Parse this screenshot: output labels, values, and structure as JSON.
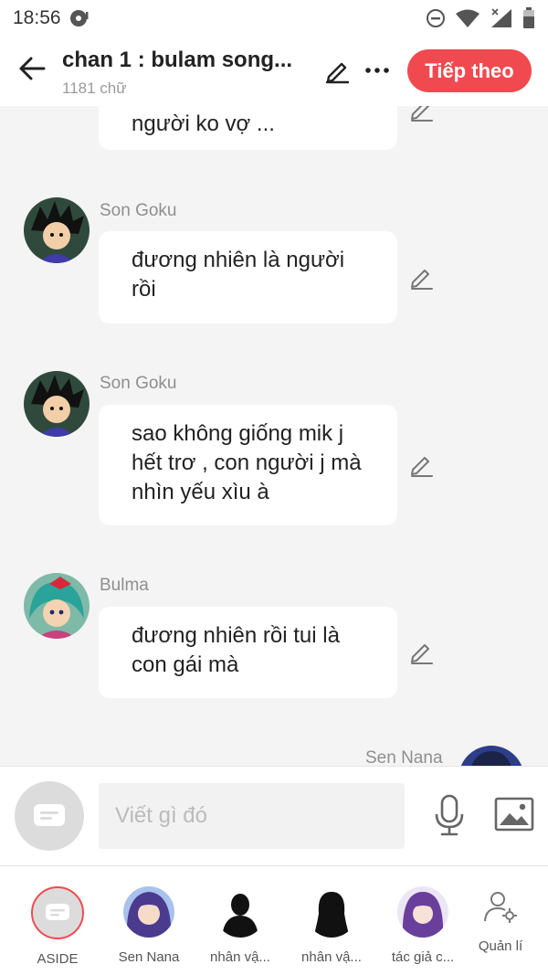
{
  "status_bar": {
    "time": "18:56",
    "icons": [
      "media-icon",
      "do-not-disturb-icon",
      "wifi-icon",
      "signal-icon",
      "battery-icon"
    ]
  },
  "header": {
    "title": "chan 1 : bulam song...",
    "word_count": "1181 chữ",
    "next_label": "Tiếp theo"
  },
  "chat": {
    "messages": [
      {
        "speaker": "",
        "text": "người ko vợ ..."
      },
      {
        "speaker": "Son Goku",
        "text": "đương nhiên là người rồi"
      },
      {
        "speaker": "Son Goku",
        "text": "sao không giống mik j hết trơ , con người j mà nhìn yếu xìu à"
      },
      {
        "speaker": "Bulma",
        "text": "đương nhiên rồi tui là con gái mà"
      },
      {
        "speaker": "Sen Nana",
        "text": ""
      }
    ]
  },
  "composer": {
    "placeholder": "Viết gì đó"
  },
  "characters": [
    {
      "label": "ASIDE"
    },
    {
      "label": "Sen Nana"
    },
    {
      "label": "nhân vậ..."
    },
    {
      "label": "nhân vậ..."
    },
    {
      "label": "tác giả c..."
    },
    {
      "label": "Quản lí"
    }
  ],
  "colors": {
    "accent": "#f04a50",
    "background": "#f4f4f4"
  }
}
